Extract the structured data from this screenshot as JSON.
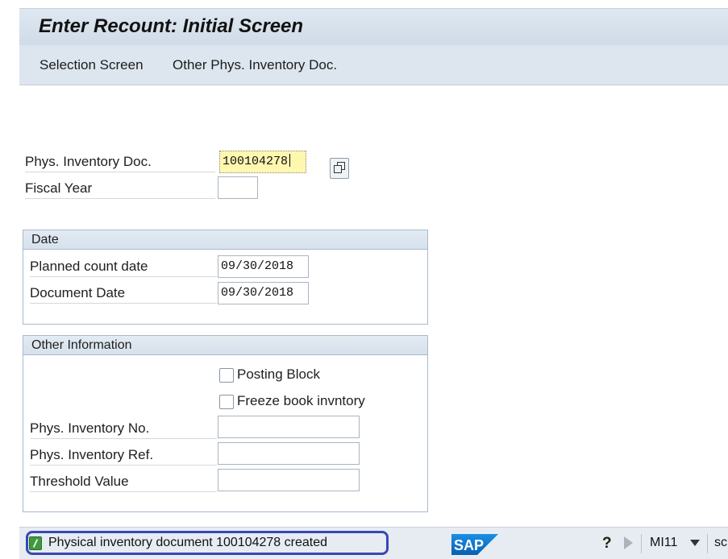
{
  "window": {
    "title": "Enter Recount: Initial Screen"
  },
  "toolbar": {
    "selection_screen": "Selection Screen",
    "other_doc": "Other Phys. Inventory Doc."
  },
  "form": {
    "phys_inv_doc_label": "Phys. Inventory Doc.",
    "phys_inv_doc_value": "100104278",
    "fiscal_year_label": "Fiscal Year",
    "fiscal_year_value": ""
  },
  "date_group": {
    "title": "Date",
    "planned_count_label": "Planned count date",
    "planned_count_value": "09/30/2018",
    "document_date_label": "Document Date",
    "document_date_value": "09/30/2018"
  },
  "other_group": {
    "title": "Other Information",
    "posting_block_label": "Posting Block",
    "posting_block_checked": false,
    "freeze_label": "Freeze book invntory",
    "freeze_checked": false,
    "phys_inv_no_label": "Phys. Inventory No.",
    "phys_inv_no_value": "",
    "phys_inv_ref_label": "Phys. Inventory Ref.",
    "phys_inv_ref_value": "",
    "threshold_label": "Threshold Value",
    "threshold_value": ""
  },
  "status": {
    "message": "Physical inventory document 100104278 created",
    "icon": "success-icon",
    "logo_text": "SAP",
    "tcode": "MI11",
    "server": "sc"
  },
  "colors": {
    "title_bar": "#dfe8f1",
    "highlight_border": "#3b47b5",
    "focus_field": "#fff7b0",
    "sap_logo": "#0a6ed1"
  }
}
